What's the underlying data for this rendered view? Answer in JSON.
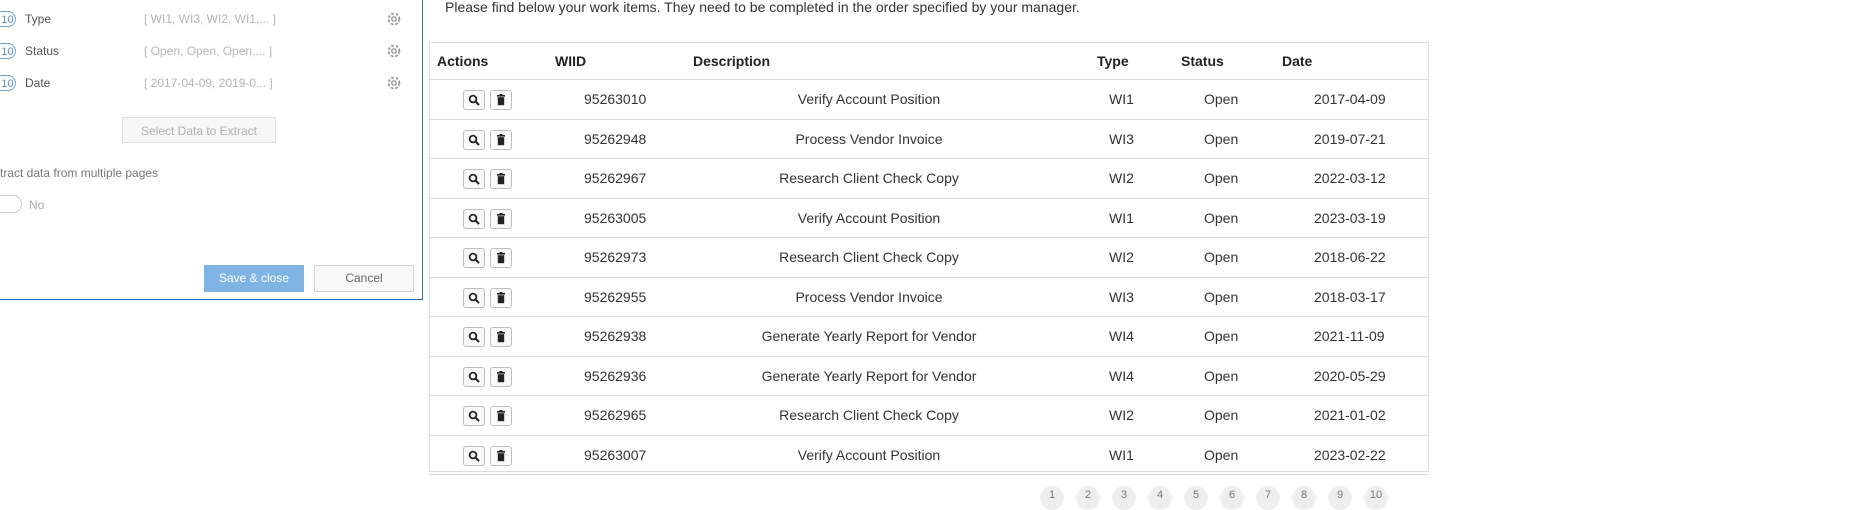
{
  "panel": {
    "fields": [
      {
        "count": "10",
        "name": "Type",
        "values": "[ WI1, WI3, WI2, WI1,... ]"
      },
      {
        "count": "10",
        "name": "Status",
        "values": "[ Open, Open, Open,... ]"
      },
      {
        "count": "10",
        "name": "Date",
        "values": "[ 2017-04-09, 2019-0... ]"
      }
    ],
    "select_button": "Select Data to Extract",
    "multi_page_label": "tract data from multiple pages",
    "toggle_text": "No",
    "save_button": "Save & close",
    "cancel_button": "Cancel"
  },
  "instructions": "Please find below your work items. They need to be completed in the order specified by your manager.",
  "table": {
    "headers": {
      "actions": "Actions",
      "wiid": "WIID",
      "description": "Description",
      "type": "Type",
      "status": "Status",
      "date": "Date"
    },
    "rows": [
      {
        "wiid": "95263010",
        "description": "Verify Account Position",
        "type": "WI1",
        "status": "Open",
        "date": "2017-04-09"
      },
      {
        "wiid": "95262948",
        "description": "Process Vendor Invoice",
        "type": "WI3",
        "status": "Open",
        "date": "2019-07-21"
      },
      {
        "wiid": "95262967",
        "description": "Research Client Check Copy",
        "type": "WI2",
        "status": "Open",
        "date": "2022-03-12"
      },
      {
        "wiid": "95263005",
        "description": "Verify Account Position",
        "type": "WI1",
        "status": "Open",
        "date": "2023-03-19"
      },
      {
        "wiid": "95262973",
        "description": "Research Client Check Copy",
        "type": "WI2",
        "status": "Open",
        "date": "2018-06-22"
      },
      {
        "wiid": "95262955",
        "description": "Process Vendor Invoice",
        "type": "WI3",
        "status": "Open",
        "date": "2018-03-17"
      },
      {
        "wiid": "95262938",
        "description": "Generate Yearly Report for Vendor",
        "type": "WI4",
        "status": "Open",
        "date": "2021-11-09"
      },
      {
        "wiid": "95262936",
        "description": "Generate Yearly Report for Vendor",
        "type": "WI4",
        "status": "Open",
        "date": "2020-05-29"
      },
      {
        "wiid": "95262965",
        "description": "Research Client Check Copy",
        "type": "WI2",
        "status": "Open",
        "date": "2021-01-02"
      },
      {
        "wiid": "95263007",
        "description": "Verify Account Position",
        "type": "WI1",
        "status": "Open",
        "date": "2023-02-22"
      }
    ],
    "icons": {
      "view": "search-icon",
      "delete": "trash-icon"
    }
  },
  "pagination": {
    "pages": [
      "1",
      "2",
      "3",
      "4",
      "5",
      "6",
      "7",
      "8",
      "9",
      "10"
    ]
  }
}
